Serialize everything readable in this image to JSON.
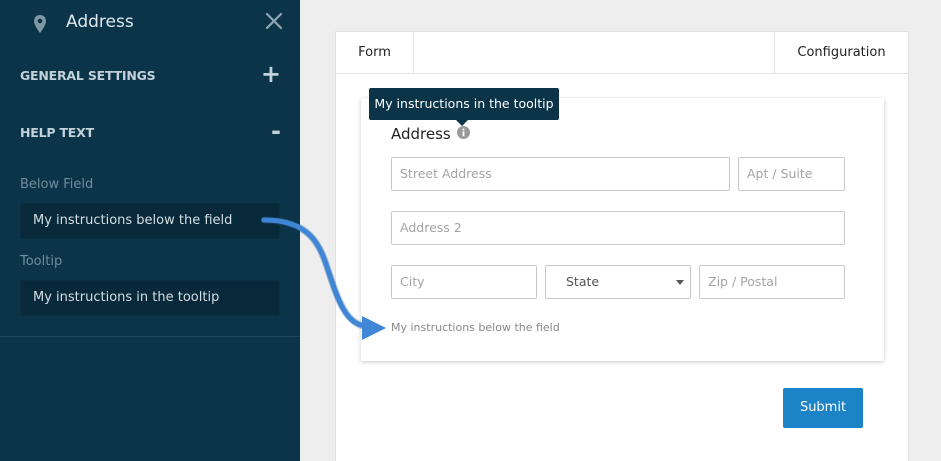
{
  "sidebar": {
    "title": "Address",
    "sections": [
      {
        "label": "GENERAL SETTINGS",
        "toggle": "+"
      },
      {
        "label": "HELP TEXT",
        "toggle": "-"
      }
    ],
    "fields": {
      "below_field": {
        "label": "Below Field",
        "value": "My instructions below the field"
      },
      "tooltip": {
        "label": "Tooltip",
        "value": "My instructions in the tooltip"
      }
    }
  },
  "tabs": {
    "form": "Form",
    "configuration": "Configuration"
  },
  "form": {
    "field_title": "Address",
    "tooltip_text": "My instructions in the tooltip",
    "placeholders": {
      "street": "Street Address",
      "apt": "Apt / Suite",
      "address2": "Address 2",
      "city": "City",
      "state": "State",
      "zip": "Zip / Postal"
    },
    "help_text": "My instructions below the field",
    "submit_label": "Submit"
  },
  "colors": {
    "sidebar_bg": "#0c3448",
    "accent": "#1c84c6",
    "callout_arrow": "#3f86d6"
  },
  "icons": [
    "map-pin-icon",
    "close-icon",
    "plus-icon",
    "minus-icon",
    "info-icon",
    "chevron-down-icon",
    "callout-arrow-icon"
  ]
}
